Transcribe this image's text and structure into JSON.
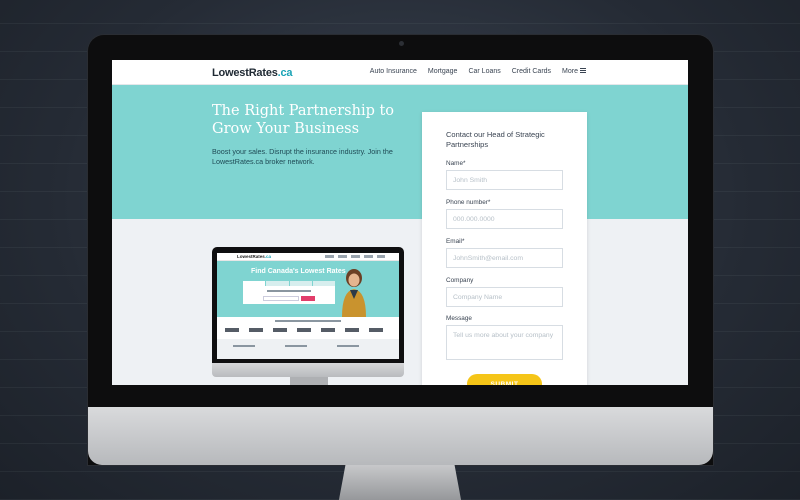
{
  "nav": {
    "logo": "LowestRates",
    "logo_suffix": ".ca",
    "links": [
      "Auto Insurance",
      "Mortgage",
      "Car Loans",
      "Credit Cards",
      "More"
    ],
    "menu_icon": "hamburger-icon"
  },
  "hero": {
    "title": "The Right Partnership to Grow Your Business",
    "subtitle": "Boost your sales. Disrupt the insurance industry. Join the LowestRates.ca broker network."
  },
  "mini_site": {
    "logo": "LowestRates",
    "logo_suffix": ".ca",
    "headline": "Find Canada's Lowest Rates"
  },
  "form": {
    "title": "Contact our Head of Strategic Partnerships",
    "fields": {
      "name": {
        "label": "Name*",
        "placeholder": "John Smith"
      },
      "phone": {
        "label": "Phone number*",
        "placeholder": "000.000.0000"
      },
      "email": {
        "label": "Email*",
        "placeholder": "JohnSmith@email.com"
      },
      "company": {
        "label": "Company",
        "placeholder": "Company Name"
      },
      "message": {
        "label": "Message",
        "placeholder": "Tell us more about your company"
      }
    },
    "submit_label": "SUBMIT"
  },
  "colors": {
    "accent_teal": "#7fd4d1",
    "brand_teal": "#1aa3b5",
    "submit_yellow": "#f5c518"
  }
}
